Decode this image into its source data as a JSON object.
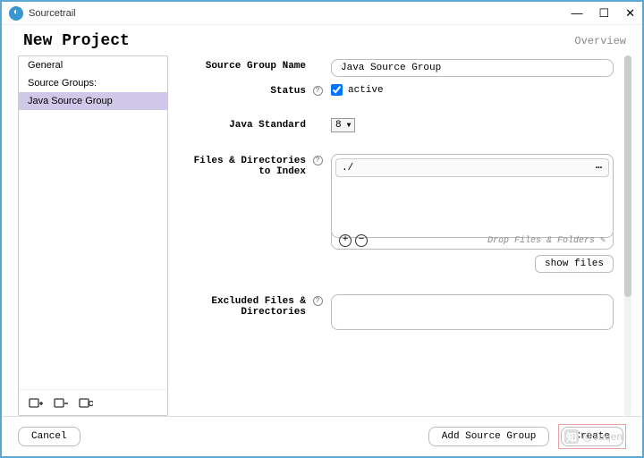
{
  "window": {
    "title": "Sourcetrail"
  },
  "header": {
    "title": "New Project",
    "overview": "Overview"
  },
  "sidebar": {
    "items": [
      {
        "label": "General",
        "selected": false
      },
      {
        "label": "Source Groups:",
        "selected": false
      },
      {
        "label": "Java Source Group",
        "selected": true
      }
    ]
  },
  "form": {
    "source_group_name": {
      "label": "Source Group Name",
      "value": "Java Source Group"
    },
    "status": {
      "label": "Status",
      "checkbox_label": "active",
      "checked": true
    },
    "java_standard": {
      "label": "Java Standard",
      "value": "8"
    },
    "files_to_index": {
      "label": "Files & Directories to Index",
      "entries": [
        "./"
      ],
      "drop_hint": "Drop Files & Folders",
      "show_files_label": "show files"
    },
    "excluded": {
      "label": "Excluded Files & Directories"
    }
  },
  "footer": {
    "cancel": "Cancel",
    "add_source_group": "Add Source Group",
    "create": "Create"
  },
  "watermark": "@Jaqen"
}
